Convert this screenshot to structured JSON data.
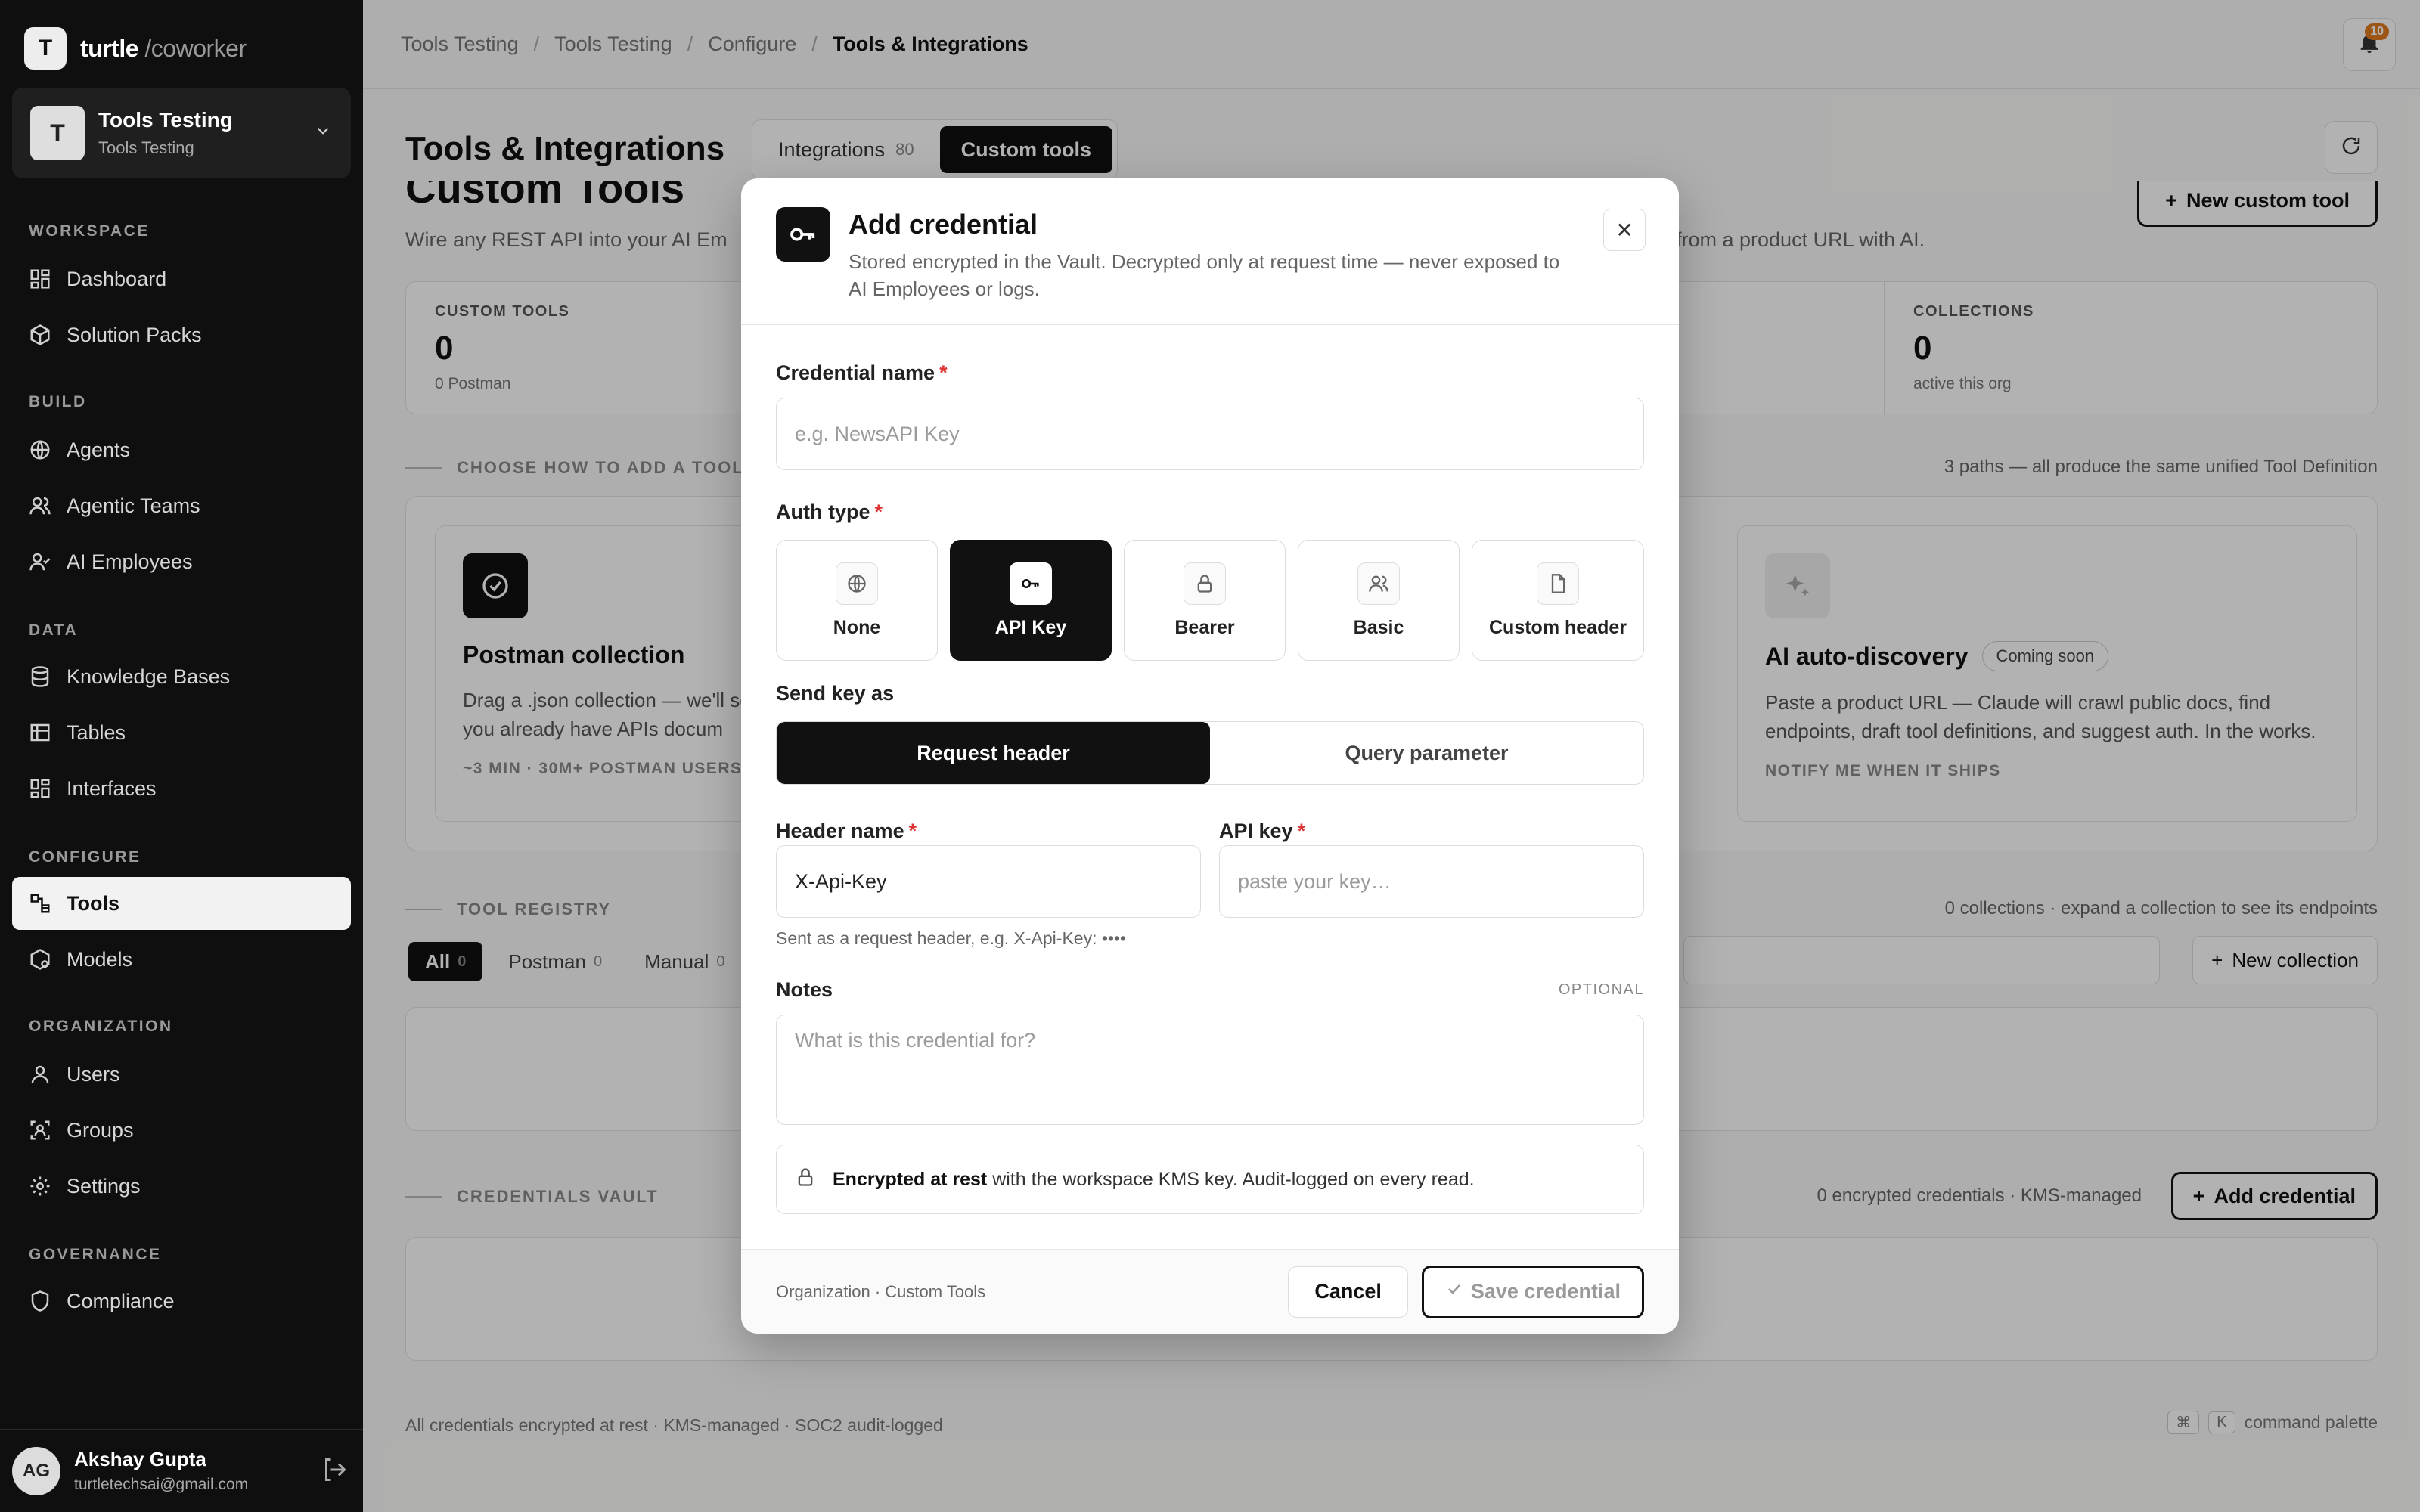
{
  "brand": {
    "logo_letter": "T",
    "name": "turtle",
    "suffix": "/coworker"
  },
  "org": {
    "avatar": "T",
    "name": "Tools Testing",
    "sub": "Tools Testing"
  },
  "nav": {
    "sections": {
      "workspace": "WORKSPACE",
      "build": "BUILD",
      "data": "DATA",
      "configure": "CONFIGURE",
      "organization": "ORGANIZATION",
      "governance": "GOVERNANCE"
    },
    "items": {
      "dashboard": "Dashboard",
      "solution_packs": "Solution Packs",
      "agents": "Agents",
      "agentic_teams": "Agentic Teams",
      "ai_employees": "AI Employees",
      "knowledge_bases": "Knowledge Bases",
      "tables": "Tables",
      "interfaces": "Interfaces",
      "tools": "Tools",
      "models": "Models",
      "users": "Users",
      "groups": "Groups",
      "settings": "Settings",
      "compliance": "Compliance"
    }
  },
  "user": {
    "initials": "AG",
    "name": "Akshay Gupta",
    "email": "turtletechsai@gmail.com"
  },
  "breadcrumb": [
    "Tools Testing",
    "Tools Testing",
    "Configure",
    "Tools & Integrations"
  ],
  "notifications": {
    "count": "10"
  },
  "page": {
    "title": "Tools & Integrations",
    "tabs": [
      {
        "label": "Integrations",
        "count": "80"
      },
      {
        "label": "Custom tools"
      }
    ]
  },
  "background": {
    "section_title": "Custom Tools",
    "desc_left": "Wire any REST API into your AI Em",
    "desc_right": "from a product URL with AI.",
    "new_tool_label": "New custom tool",
    "stats": {
      "custom_tools": {
        "label": "CUSTOM TOOLS",
        "value": "0",
        "sub": "0 Postman"
      },
      "collections": {
        "label": "COLLECTIONS",
        "value": "0",
        "sub": "active this org"
      }
    },
    "choose": {
      "label": "CHOOSE HOW TO ADD A TOOL",
      "right": "3 paths — all produce the same unified Tool Definition"
    },
    "postman": {
      "title": "Postman collection",
      "desc": "Drag a .json collection — we'll schemas from examples, and you already have APIs docum",
      "foot": "~3 MIN · 30M+ POSTMAN USERS"
    },
    "ai": {
      "title": "AI auto-discovery",
      "badge": "Coming soon",
      "desc": "Paste a product URL — Claude will crawl public docs, find endpoints, draft tool definitions, and suggest auth. In the works.",
      "foot": "NOTIFY ME WHEN IT SHIPS"
    },
    "registry": {
      "label": "TOOL REGISTRY",
      "right": "0 collections · expand a collection to see its endpoints",
      "filters": [
        {
          "label": "All",
          "count": "0"
        },
        {
          "label": "Postman",
          "count": "0"
        },
        {
          "label": "Manual",
          "count": "0"
        }
      ],
      "new_collection": "New collection"
    },
    "vault": {
      "label": "CREDENTIALS VAULT",
      "right": "0 encrypted credentials · KMS-managed",
      "add_label": "Add credential"
    },
    "footer_left": "All credentials encrypted at rest · KMS-managed · SOC2 audit-logged",
    "footer_keys": [
      "⌘",
      "K"
    ],
    "footer_right": "command palette"
  },
  "modal": {
    "title": "Add credential",
    "description": "Stored encrypted in the Vault. Decrypted only at request time — never exposed to AI Employees or logs.",
    "close": "✕",
    "credential_name": {
      "label": "Credential name",
      "required": "*",
      "placeholder": "e.g. NewsAPI Key"
    },
    "auth_type": {
      "label": "Auth type",
      "required": "*",
      "options": [
        "None",
        "API Key",
        "Bearer",
        "Basic",
        "Custom header"
      ],
      "selected": "API Key"
    },
    "send_as": {
      "label": "Send key as",
      "options": [
        "Request header",
        "Query parameter"
      ],
      "selected": "Request header"
    },
    "header_name": {
      "label": "Header name",
      "required": "*",
      "value": "X-Api-Key"
    },
    "api_key": {
      "label": "API key",
      "required": "*",
      "placeholder": "paste your key…"
    },
    "help": "Sent as a request header, e.g. X-Api-Key: ••••",
    "notes": {
      "label": "Notes",
      "optional": "OPTIONAL",
      "placeholder": "What is this credential for?"
    },
    "encrypted": {
      "bold": "Encrypted at rest",
      "rest": "with the workspace KMS key. Audit-logged on every read."
    },
    "footer_left": "Organization · Custom Tools",
    "cancel": "Cancel",
    "save": "Save credential"
  }
}
